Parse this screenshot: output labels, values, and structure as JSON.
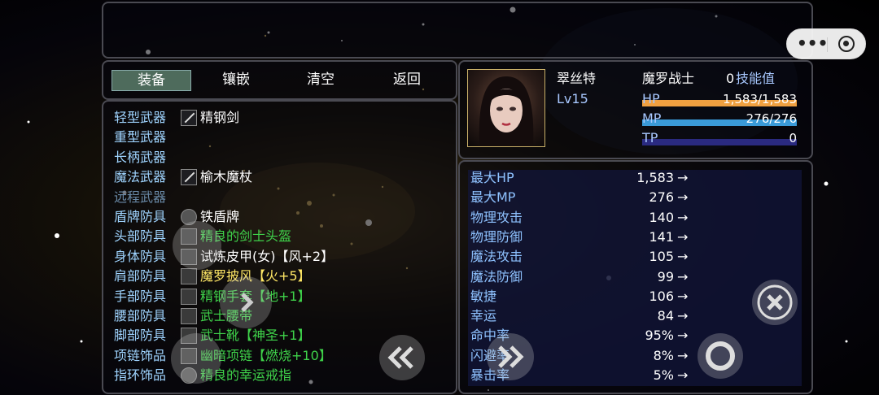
{
  "capsule": {
    "more_label": "•••"
  },
  "menu": {
    "tabs": [
      {
        "label": "装备",
        "active": true
      },
      {
        "label": "镶嵌"
      },
      {
        "label": "清空"
      },
      {
        "label": "返回"
      }
    ]
  },
  "equipment": {
    "slots": [
      {
        "label": "轻型武器",
        "item": "精钢剑",
        "icon": "sword-icon",
        "color": "white"
      },
      {
        "label": "重型武器",
        "item": ""
      },
      {
        "label": "长柄武器",
        "item": ""
      },
      {
        "label": "魔法武器",
        "item": "榆木魔杖",
        "icon": "staff-icon",
        "color": "white"
      },
      {
        "label": "远程武器",
        "item": "",
        "dim": true
      },
      {
        "label": "盾牌防具",
        "item": "铁盾牌",
        "icon": "shield-icon",
        "color": "white"
      },
      {
        "label": "头部防具",
        "item": "精良的剑士头盔",
        "icon": "helmet-icon",
        "color": "green"
      },
      {
        "label": "身体防具",
        "item": "试炼皮甲(女)【风+2】",
        "icon": "armor-icon",
        "color": "white"
      },
      {
        "label": "肩部防具",
        "item": "魔罗披风【火+5】",
        "icon": "cloak-icon",
        "color": "yellow"
      },
      {
        "label": "手部防具",
        "item": "精钢手套【地+1】",
        "icon": "gloves-icon",
        "color": "green"
      },
      {
        "label": "腰部防具",
        "item": "武士腰带",
        "icon": "belt-icon",
        "color": "green"
      },
      {
        "label": "脚部防具",
        "item": "武士靴【神圣+1】",
        "icon": "boots-icon",
        "color": "green"
      },
      {
        "label": "项链饰品",
        "item": "幽暗项链【燃烧+10】",
        "icon": "necklace-icon",
        "color": "green"
      },
      {
        "label": "指环饰品",
        "item": "精良的幸运戒指",
        "icon": "ring-icon",
        "color": "green"
      }
    ]
  },
  "character": {
    "name": "翠丝特",
    "level": "Lv15",
    "class": "魔罗战士",
    "skill_points": "0",
    "skill_label": "技能值",
    "hp_label": "HP",
    "hp_value": "1,583/1,583",
    "hp_fraction": 1.0,
    "mp_label": "MP",
    "mp_value": "276/276",
    "mp_fraction": 1.0,
    "tp_label": "TP",
    "tp_value": "0",
    "tp_fraction": 0.0
  },
  "stats": [
    {
      "name": "最大HP",
      "value": "1,583"
    },
    {
      "name": "最大MP",
      "value": "276"
    },
    {
      "name": "物理攻击",
      "value": "140"
    },
    {
      "name": "物理防御",
      "value": "141"
    },
    {
      "name": "魔法攻击",
      "value": "105"
    },
    {
      "name": "魔法防御",
      "value": "99"
    },
    {
      "name": "敏捷",
      "value": "106"
    },
    {
      "name": "幸运",
      "value": "84"
    },
    {
      "name": "命中率",
      "value": "95%"
    },
    {
      "name": "闪避率",
      "value": "8%"
    },
    {
      "name": "暴击率",
      "value": "5%"
    }
  ],
  "arrow": "→",
  "colors": {
    "hp": "#f0a040",
    "mp": "#3a9ad8",
    "tp": "#2a2a80",
    "accent_text": "#9fd4ff",
    "green_item": "#3fd24a",
    "yellow_item": "#ffe866"
  }
}
